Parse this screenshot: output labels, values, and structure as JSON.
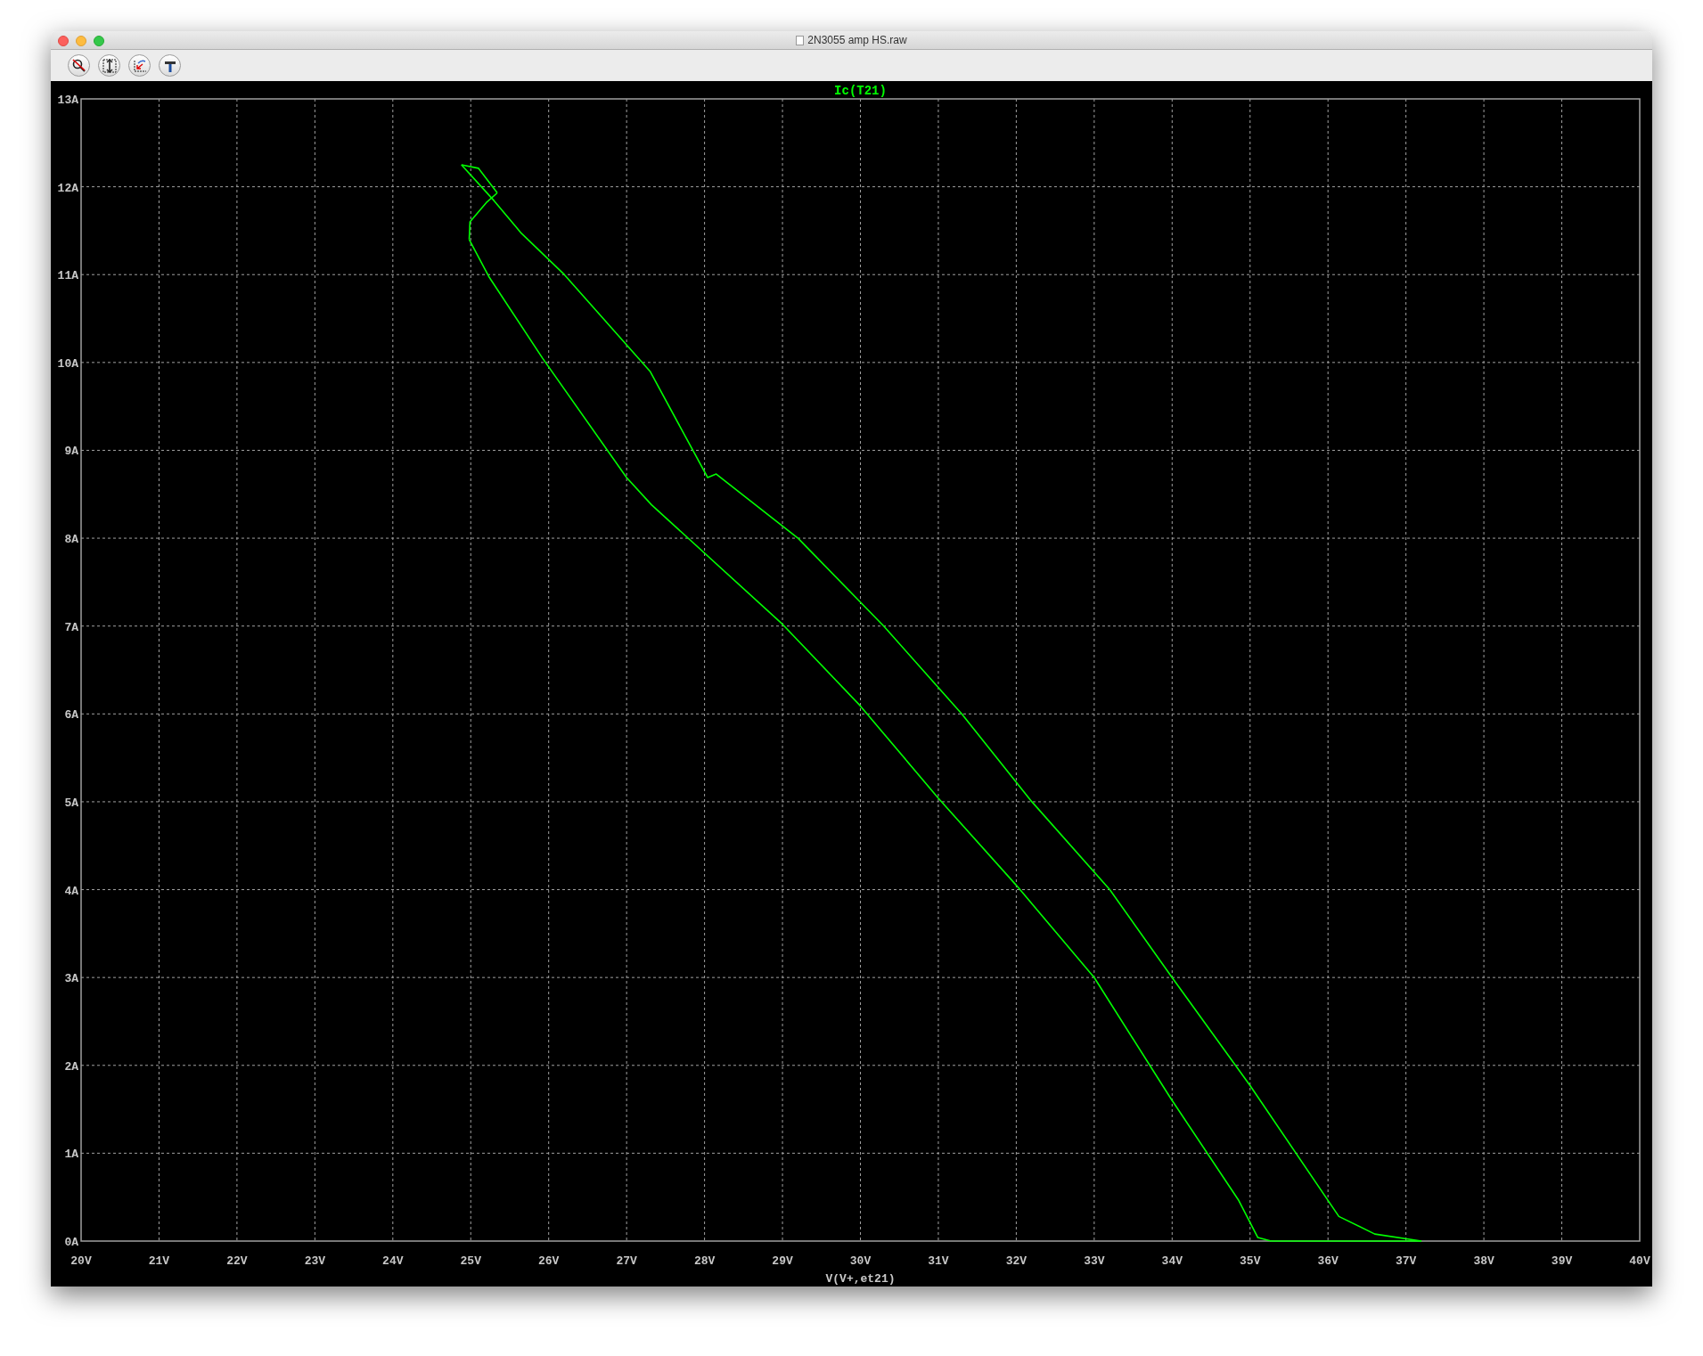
{
  "window": {
    "title": "2N3055 amp HS.raw"
  },
  "toolbar": {
    "buttons": [
      {
        "kind": "zoom-cancel"
      },
      {
        "kind": "autorange"
      },
      {
        "kind": "pan-back"
      },
      {
        "kind": "tool"
      }
    ]
  },
  "plot": {
    "chart_data": {
      "type": "line",
      "title": "Ic(T21)",
      "xlabel": "V(V+,et21)",
      "grid": true,
      "x": [
        37.2,
        36.6,
        36.14,
        35.0,
        34.0,
        33.2,
        32.2,
        31.3,
        30.3,
        29.2,
        28.15,
        28.04,
        27.3,
        26.2,
        25.65,
        25.3,
        24.88,
        25.1,
        25.34,
        25.2,
        24.99,
        24.98,
        25.23,
        25.92,
        27.0,
        27.32,
        29.0,
        30.0,
        31.0,
        32.0,
        33.0,
        33.97,
        34.85,
        35.1,
        35.27,
        37.2
      ],
      "series": [
        {
          "color": "#00ff00",
          "values": [
            0,
            0.08,
            0.28,
            1.77,
            3.0,
            4.0,
            5.0,
            6.0,
            7.0,
            8.0,
            8.73,
            8.69,
            9.9,
            11.0,
            11.47,
            11.84,
            12.25,
            null,
            null,
            null,
            null,
            null,
            null,
            null,
            null,
            null,
            null,
            null,
            null,
            null,
            null,
            null,
            null,
            null,
            null,
            null
          ]
        },
        {
          "color": "#00ff00",
          "values": [
            null,
            null,
            null,
            null,
            null,
            null,
            null,
            null,
            null,
            null,
            null,
            null,
            null,
            null,
            null,
            null,
            12.25,
            12.21,
            11.93,
            null,
            null,
            null,
            null,
            null,
            null,
            null,
            null,
            null,
            null,
            null,
            null,
            null,
            null,
            null,
            null,
            null
          ]
        },
        {
          "color": "#00ff00",
          "values": [
            null,
            null,
            null,
            null,
            null,
            null,
            null,
            null,
            null,
            null,
            null,
            null,
            null,
            null,
            null,
            null,
            null,
            null,
            11.93,
            11.82,
            11.6,
            11.4,
            null,
            null,
            null,
            null,
            null,
            null,
            null,
            null,
            null,
            null,
            null,
            null,
            null,
            null
          ]
        },
        {
          "color": "#00ff00",
          "values": [
            null,
            null,
            null,
            null,
            null,
            null,
            null,
            null,
            null,
            null,
            null,
            null,
            null,
            null,
            null,
            null,
            null,
            null,
            null,
            null,
            null,
            11.4,
            10.98,
            10.05,
            8.69,
            8.38,
            7.02,
            6.09,
            5.04,
            4.05,
            3.0,
            1.64,
            0.47,
            0.04,
            0,
            0
          ]
        }
      ],
      "xlim": [
        20,
        40
      ],
      "ylim": [
        0,
        13
      ],
      "xticks": [
        {
          "value": 20,
          "label": "20V"
        },
        {
          "value": 21,
          "label": "21V"
        },
        {
          "value": 22,
          "label": "22V"
        },
        {
          "value": 23,
          "label": "23V"
        },
        {
          "value": 24,
          "label": "24V"
        },
        {
          "value": 25,
          "label": "25V"
        },
        {
          "value": 26,
          "label": "26V"
        },
        {
          "value": 27,
          "label": "27V"
        },
        {
          "value": 28,
          "label": "28V"
        },
        {
          "value": 29,
          "label": "29V"
        },
        {
          "value": 30,
          "label": "30V"
        },
        {
          "value": 31,
          "label": "31V"
        },
        {
          "value": 32,
          "label": "32V"
        },
        {
          "value": 33,
          "label": "33V"
        },
        {
          "value": 34,
          "label": "34V"
        },
        {
          "value": 35,
          "label": "35V"
        },
        {
          "value": 36,
          "label": "36V"
        },
        {
          "value": 37,
          "label": "37V"
        },
        {
          "value": 38,
          "label": "38V"
        },
        {
          "value": 39,
          "label": "39V"
        },
        {
          "value": 40,
          "label": "40V"
        }
      ],
      "yticks": [
        {
          "value": 0,
          "label": "0A"
        },
        {
          "value": 1,
          "label": "1A"
        },
        {
          "value": 2,
          "label": "2A"
        },
        {
          "value": 3,
          "label": "3A"
        },
        {
          "value": 4,
          "label": "4A"
        },
        {
          "value": 5,
          "label": "5A"
        },
        {
          "value": 6,
          "label": "6A"
        },
        {
          "value": 7,
          "label": "7A"
        },
        {
          "value": 8,
          "label": "8A"
        },
        {
          "value": 9,
          "label": "9A"
        },
        {
          "value": 10,
          "label": "10A"
        },
        {
          "value": 11,
          "label": "11A"
        },
        {
          "value": 12,
          "label": "12A"
        },
        {
          "value": 13,
          "label": "13A"
        }
      ]
    }
  }
}
